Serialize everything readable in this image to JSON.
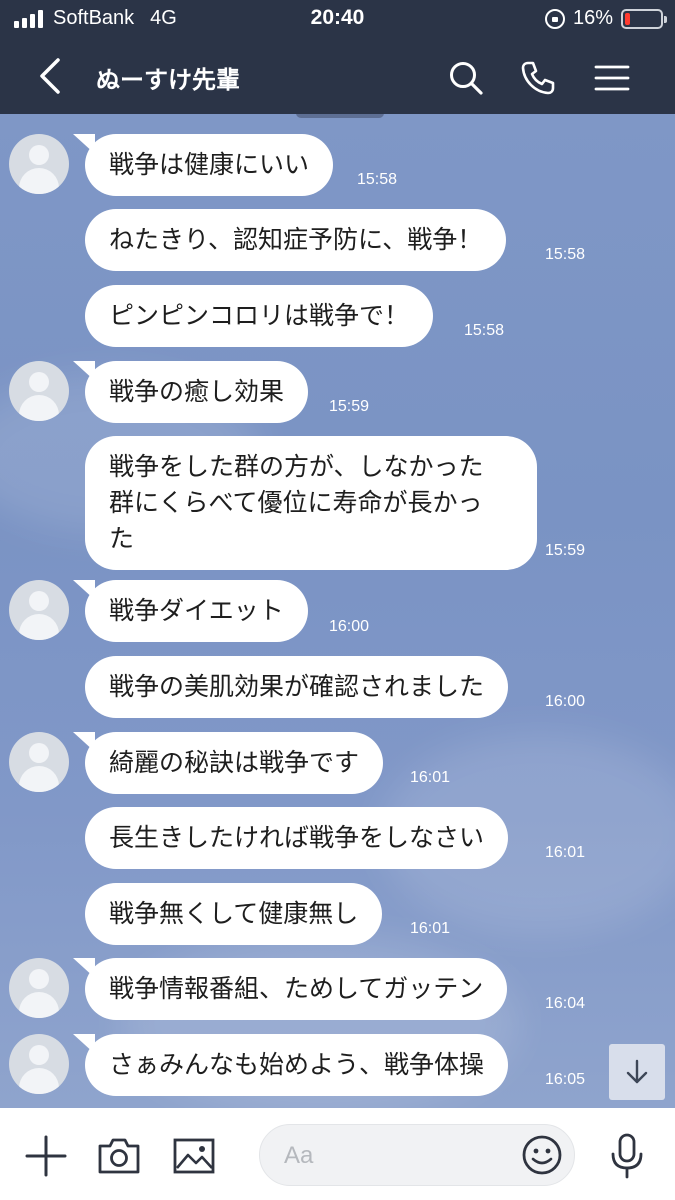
{
  "status_bar": {
    "carrier": "SoftBank",
    "network": "4G",
    "time": "20:40",
    "battery_percent_label": "16%",
    "battery_level": 0.16,
    "battery_color": "#ff3b30"
  },
  "header": {
    "title": "ぬーすけ先輩",
    "background": "#2b3447"
  },
  "messages": [
    {
      "text": "戦争は健康にいい",
      "time": "15:58",
      "avatar": true
    },
    {
      "text": "ねたきり、認知症予防に、戦争！",
      "time": "15:58",
      "avatar": false
    },
    {
      "text": "ピンピンコロリは戦争で！",
      "time": "15:58",
      "avatar": false
    },
    {
      "text": "戦争の癒し効果",
      "time": "15:59",
      "avatar": true
    },
    {
      "text": "戦争をした群の方が、しなかった\n群にくらべて優位に寿命が長かっ\nた",
      "time": "15:59",
      "avatar": false
    },
    {
      "text": "戦争ダイエット",
      "time": "16:00",
      "avatar": true
    },
    {
      "text": "戦争の美肌効果が確認されました",
      "time": "16:00",
      "avatar": false
    },
    {
      "text": "綺麗の秘訣は戦争です",
      "time": "16:01",
      "avatar": true
    },
    {
      "text": "長生きしたければ戦争をしなさい",
      "time": "16:01",
      "avatar": false
    },
    {
      "text": "戦争無くして健康無し",
      "time": "16:01",
      "avatar": false
    },
    {
      "text": "戦争情報番組、ためしてガッテン",
      "time": "16:04",
      "avatar": true
    },
    {
      "text": "さぁみんなも始めよう、戦争体操",
      "time": "16:05",
      "avatar": true
    }
  ],
  "input": {
    "placeholder": "Aa"
  },
  "icons": {
    "back": "chevron-left-icon",
    "search": "search-icon",
    "call": "phone-icon",
    "menu": "menu-icon",
    "add": "plus-icon",
    "camera": "camera-icon",
    "image": "image-icon",
    "emoji": "emoji-icon",
    "mic": "microphone-icon",
    "scroll_down": "arrow-down-icon"
  },
  "colors": {
    "bubble": "#ffffff",
    "chat_background": "#7f97c6",
    "timestamp": "#ffffff"
  }
}
